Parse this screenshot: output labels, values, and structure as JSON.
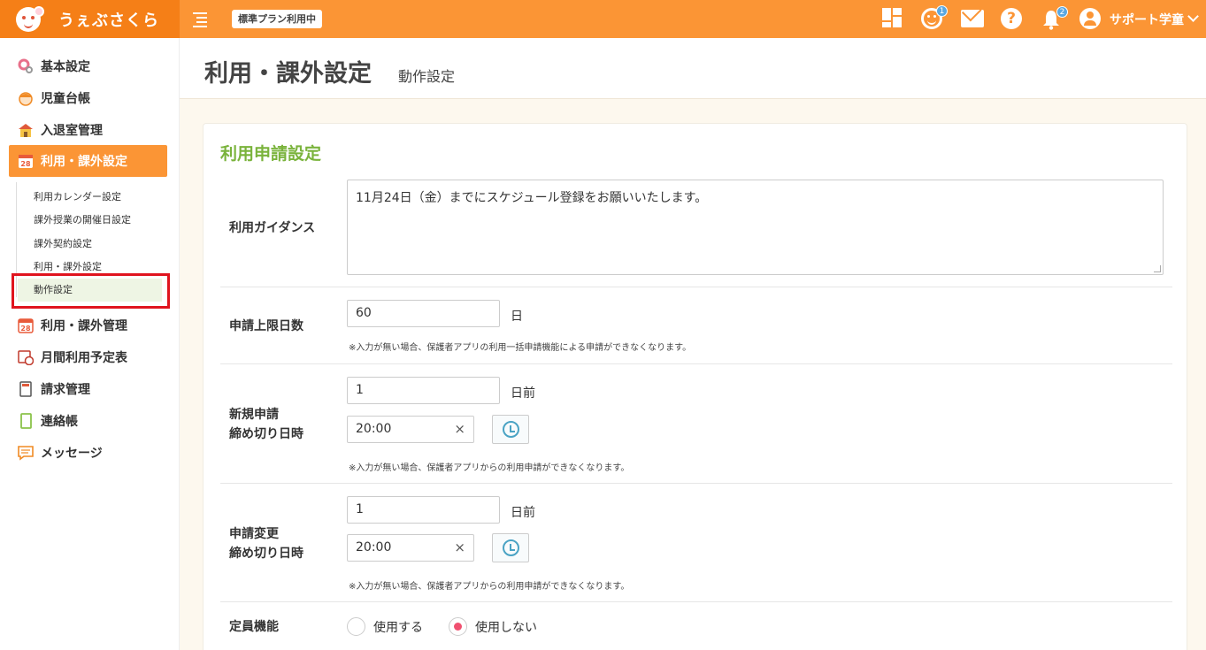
{
  "header": {
    "logo_text": "うぇぶさくら",
    "plan_badge": "標準プラン利用中",
    "smile_badge": "1",
    "bell_badge": "2",
    "user_name": "サポート学童",
    "accent_color": "#fb9535"
  },
  "sidebar": {
    "items": [
      {
        "label": "基本設定",
        "icon": "gear-icon"
      },
      {
        "label": "児童台帳",
        "icon": "child-icon"
      },
      {
        "label": "入退室管理",
        "icon": "building-icon"
      },
      {
        "label": "利用・課外設定",
        "icon": "calendar-icon",
        "active": true
      },
      {
        "label": "利用・課外管理",
        "icon": "calendar-icon"
      },
      {
        "label": "月間利用予定表",
        "icon": "calendar-clock-icon"
      },
      {
        "label": "請求管理",
        "icon": "calculator-icon"
      },
      {
        "label": "連絡帳",
        "icon": "notebook-icon"
      },
      {
        "label": "メッセージ",
        "icon": "message-icon"
      }
    ],
    "sub_items": [
      {
        "label": "利用カレンダー設定"
      },
      {
        "label": "課外授業の開催日設定"
      },
      {
        "label": "課外契約設定"
      },
      {
        "label": "利用・課外設定"
      },
      {
        "label": "動作設定",
        "current": true
      }
    ],
    "calendar_icon_text": "28"
  },
  "page": {
    "title": "利用・課外設定",
    "subtitle": "動作設定"
  },
  "card": {
    "title": "利用申請設定",
    "guidance": {
      "label": "利用ガイダンス",
      "value": "11月24日（金）までにスケジュール登録をお願いいたします。"
    },
    "limit_days": {
      "label": "申請上限日数",
      "value": "60",
      "unit": "日",
      "note": "※入力が無い場合、保護者アプリの利用一括申請機能による申請ができなくなります。"
    },
    "new_deadline": {
      "label_line1": "新規申請",
      "label_line2": "締め切り日時",
      "days_value": "1",
      "days_unit": "日前",
      "time_value": "20:00",
      "clear": "×",
      "note": "※入力が無い場合、保護者アプリからの利用申請ができなくなります。"
    },
    "change_deadline": {
      "label_line1": "申請変更",
      "label_line2": "締め切り日時",
      "days_value": "1",
      "days_unit": "日前",
      "time_value": "20:00",
      "clear": "×",
      "note": "※入力が無い場合、保護者アプリからの利用申請ができなくなります。"
    },
    "capacity": {
      "label": "定員機能",
      "option_use": "使用する",
      "option_not_use": "使用しない",
      "selected": "使用しない"
    }
  }
}
